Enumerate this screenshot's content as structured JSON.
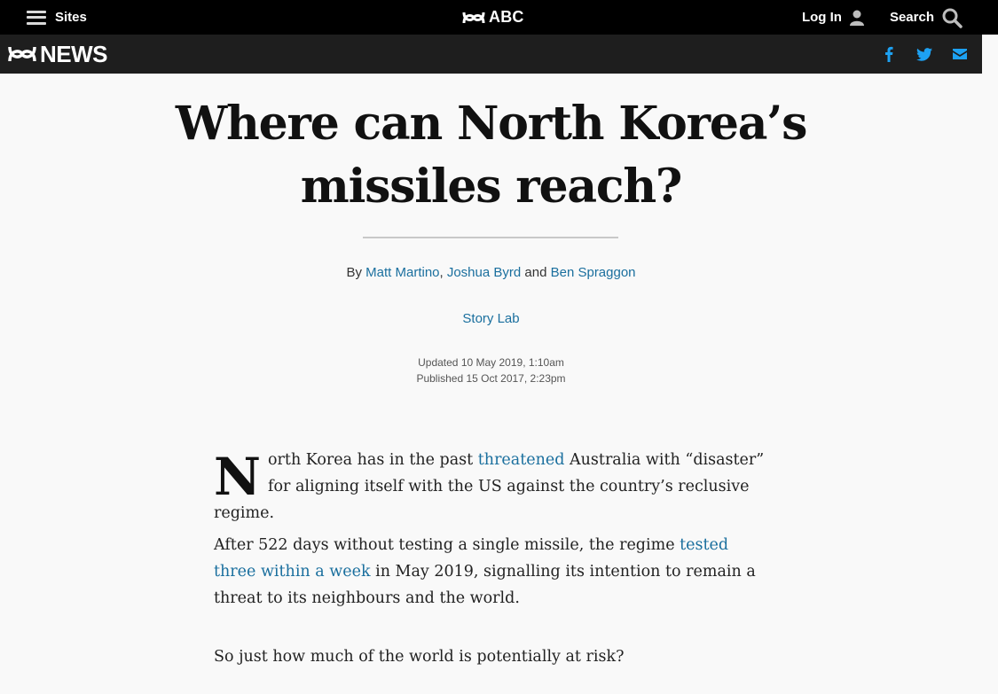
{
  "topbar": {
    "sites_label": "Sites",
    "brand_label": "ABC",
    "login_label": "Log In",
    "search_label": "Search"
  },
  "newsbar": {
    "logo_label": "NEWS",
    "share_icons": [
      "facebook-icon",
      "twitter-icon",
      "email-icon"
    ],
    "share_color": "#1da1f2"
  },
  "article": {
    "headline_line1": "Where can North Korea’s",
    "headline_line2": "missiles reach?",
    "byline": {
      "prefix": "By",
      "author1": "Matt Martino",
      "sep": ",",
      "author2": "Joshua Byrd",
      "and": "and",
      "author3": "Ben Spraggon"
    },
    "program": "Story Lab",
    "updated": "Updated 10 May 2019, 1:10am",
    "published": "Published 15 Oct 2017, 2:23pm",
    "p1": {
      "dropcap": "N",
      "text_before": "orth Korea has in the past ",
      "link": "threatened",
      "text_after": " Australia with “disaster” for aligning itself with the US against the country’s reclusive regime."
    },
    "p2": {
      "text_before": "After 522 days without testing a single missile, the regime ",
      "link": "tested three within a week",
      "text_after": " in May 2019, signalling its intention to remain a threat to its neighbours and the world."
    },
    "p3": {
      "text": "So just how much of the world is potentially at risk?"
    }
  },
  "colors": {
    "link": "#1a6f9e",
    "topbar_bg": "#000000",
    "newsbar_bg": "#1e1e1e",
    "page_bg": "#f9f9f9"
  }
}
